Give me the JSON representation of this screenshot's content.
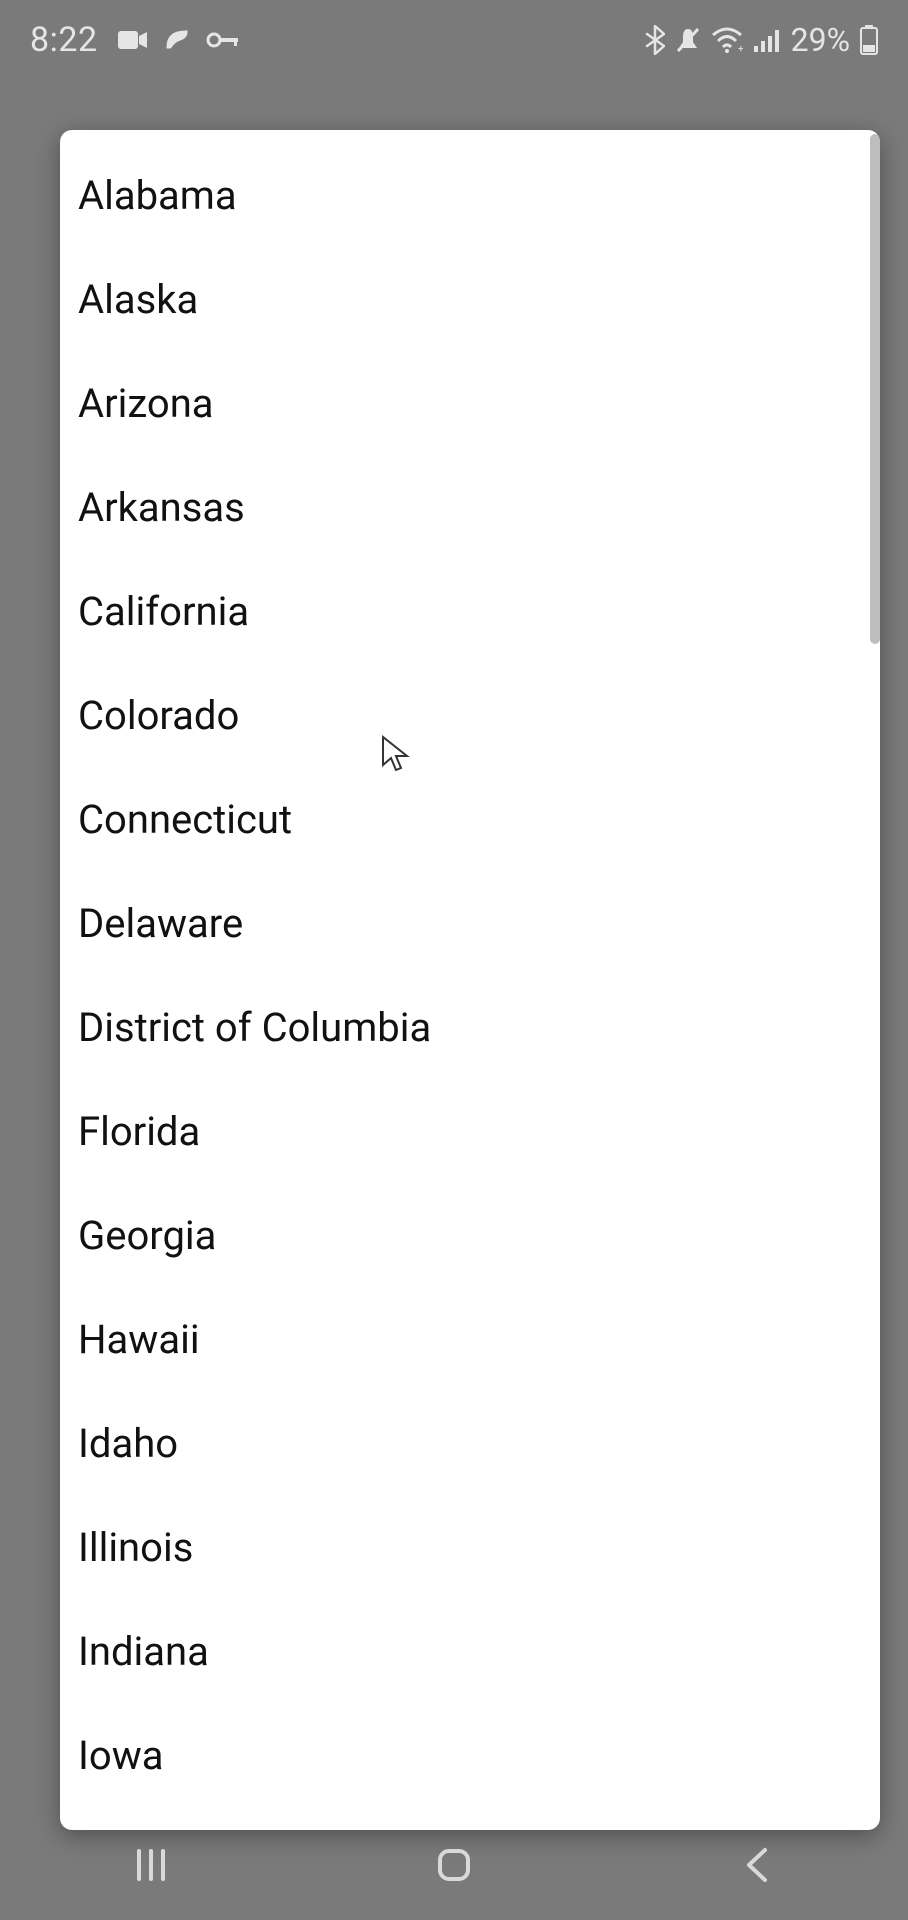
{
  "statusbar": {
    "time": "8:22",
    "left_icons": [
      "video-icon",
      "cast-icon",
      "key-icon"
    ],
    "right_icons": [
      "bluetooth-icon",
      "mute-icon",
      "wifi-icon",
      "signal-icon"
    ],
    "battery_text": "29%",
    "battery_icon": "battery-icon"
  },
  "modal": {
    "items": [
      "Alabama",
      "Alaska",
      "Arizona",
      "Arkansas",
      "California",
      "Colorado",
      "Connecticut",
      "Delaware",
      "District of Columbia",
      "Florida",
      "Georgia",
      "Hawaii",
      "Idaho",
      "Illinois",
      "Indiana",
      "Iowa"
    ]
  },
  "navbar": {
    "recents": "recents-button",
    "home": "home-button",
    "back": "back-button"
  }
}
